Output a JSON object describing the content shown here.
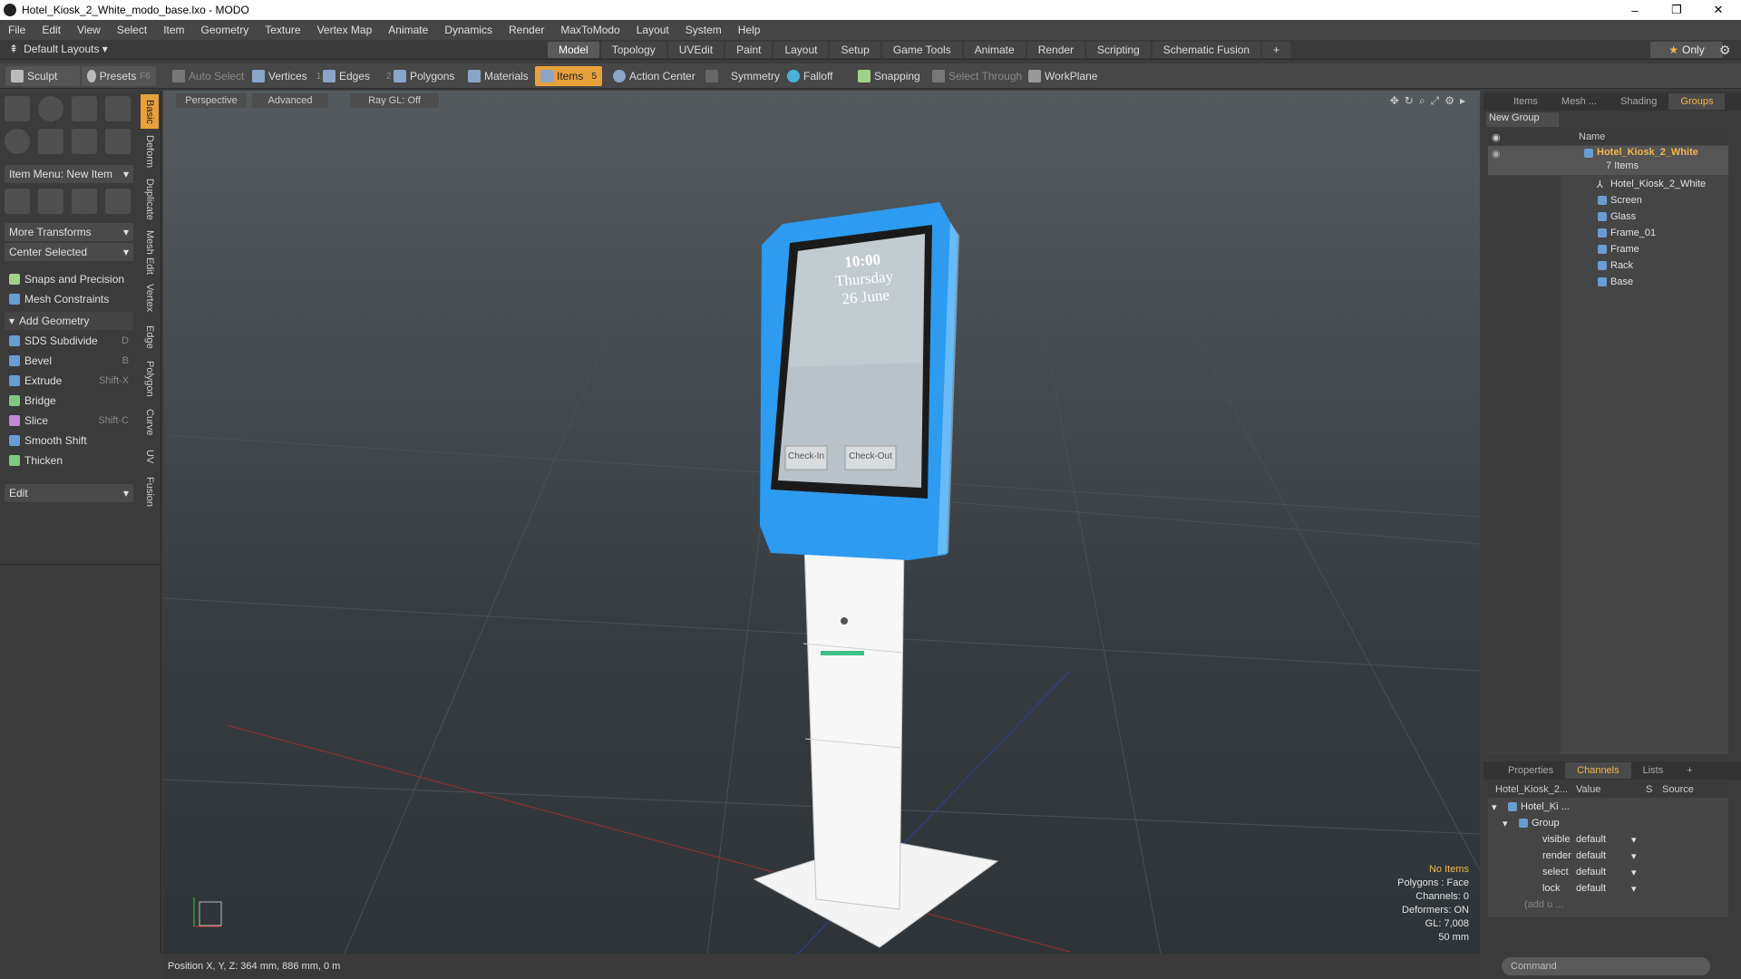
{
  "window": {
    "title": "Hotel_Kiosk_2_White_modo_base.lxo - MODO",
    "minimize": "–",
    "maximize": "❐",
    "close": "✕"
  },
  "menu": [
    "File",
    "Edit",
    "View",
    "Select",
    "Item",
    "Geometry",
    "Texture",
    "Vertex Map",
    "Animate",
    "Dynamics",
    "Render",
    "MaxToModo",
    "Layout",
    "System",
    "Help"
  ],
  "layouts": {
    "label": "Default Layouts ▾"
  },
  "tabs": [
    "Model",
    "Topology",
    "UVEdit",
    "Paint",
    "Layout",
    "Setup",
    "Game Tools",
    "Animate",
    "Render",
    "Scripting",
    "Schematic Fusion",
    "+"
  ],
  "only": {
    "label": "Only",
    "star": "★",
    "gear": "⚙"
  },
  "toolbar": {
    "sculpt": "Sculpt",
    "presets": "Presets",
    "presets_key": "F6",
    "auto_select": "Auto Select",
    "vertices": "Vertices",
    "vertices_n": "1",
    "edges": "Edges",
    "edges_n": "2",
    "polygons": "Polygons",
    "materials": "Materials",
    "items": "Items",
    "items_n": "5",
    "action_center": "Action Center",
    "symmetry": "Symmetry",
    "falloff": "Falloff",
    "snapping": "Snapping",
    "select_through": "Select Through",
    "workplane": "WorkPlane"
  },
  "left": {
    "item_menu": "Item Menu: New Item",
    "more_transforms": "More Transforms",
    "center_selected": "Center Selected",
    "snaps": "Snaps and Precision",
    "mesh_constraints": "Mesh Constraints",
    "add_geometry": "Add Geometry",
    "tools": [
      {
        "label": "SDS Subdivide",
        "key": "D"
      },
      {
        "label": "Bevel",
        "key": "B"
      },
      {
        "label": "Extrude",
        "key": "Shift-X"
      },
      {
        "label": "Bridge",
        "key": ""
      },
      {
        "label": "Slice",
        "key": "Shift-C"
      },
      {
        "label": "Smooth Shift",
        "key": ""
      },
      {
        "label": "Thicken",
        "key": ""
      }
    ],
    "edit": "Edit",
    "vtabs": [
      "Basic",
      "Deform",
      "Duplicate",
      "Mesh Edit",
      "Vertex",
      "Edge",
      "Polygon",
      "Curve",
      "UV",
      "Fusion"
    ]
  },
  "viewport": {
    "perspective": "Perspective",
    "advanced": "Advanced",
    "raygl": "Ray GL: Off",
    "screen_time": "10:00",
    "screen_day": "Thursday",
    "screen_date": "26 June",
    "checkin": "Check-In",
    "checkout": "Check-Out"
  },
  "hud": {
    "l1": "No Items",
    "l2": "Polygons : Face",
    "l3": "Channels: 0",
    "l4": "Deformers: ON",
    "l5": "GL: 7,008",
    "l6": "50 mm"
  },
  "status": {
    "text": "Position X, Y, Z:  364 mm, 886 mm, 0 m"
  },
  "right": {
    "tabs": [
      "Items",
      "Mesh ...",
      "Shading",
      "Groups"
    ],
    "new_group": "New Group",
    "name_col": "Name",
    "group_name": "Hotel_Kiosk_2_White",
    "group_count": "7 Items",
    "children": [
      "Hotel_Kiosk_2_White",
      "Screen",
      "Glass",
      "Frame_01",
      "Frame",
      "Rack",
      "Base"
    ],
    "ptabs": [
      "Properties",
      "Channels",
      "Lists",
      "+"
    ],
    "ch_cols": [
      "Hotel_Kiosk_2...",
      "Value",
      "S",
      "Source"
    ],
    "ch_root": "Hotel_Ki ...",
    "ch_group": "Group",
    "channels": [
      {
        "name": "visible",
        "value": "default"
      },
      {
        "name": "render",
        "value": "default"
      },
      {
        "name": "select",
        "value": "default"
      },
      {
        "name": "lock",
        "value": "default"
      }
    ],
    "add": "(add u ..."
  },
  "command": {
    "placeholder": "Command"
  }
}
